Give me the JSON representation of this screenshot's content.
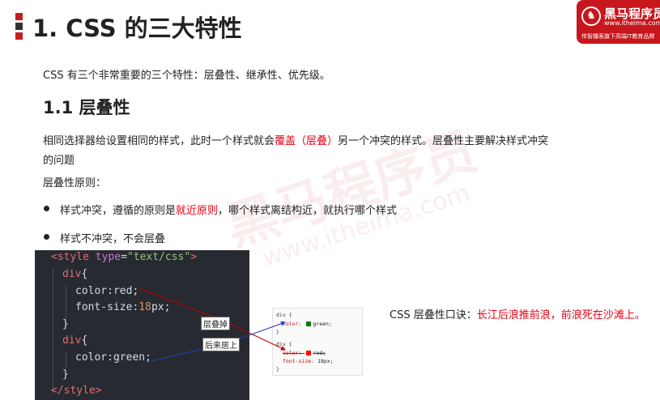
{
  "header": {
    "title": "1. CSS 的三大特性",
    "logo": {
      "name": "黑马程序员",
      "url": "www.itheima.com",
      "slogan": "传智播客旗下高端IT教育品牌"
    }
  },
  "intro": "CSS 有三个非常重要的三个特性：层叠性、继承性、优先级。",
  "section": {
    "heading": "1.1 层叠性",
    "para_a": "相同选择器给设置相同的样式，此时一个样式就会",
    "para_hl": "覆盖（层叠）",
    "para_b": "另一个冲突的样式。层叠性主要解决样式冲突",
    "para_c": "的问题",
    "principle": "层叠性原则：",
    "bullet1_a": "样式冲突，遵循的原则是",
    "bullet1_hl": "就近原则",
    "bullet1_b": "，哪个样式离结构近，就执行哪个样式",
    "bullet2": "样式不冲突，不会层叠"
  },
  "code": {
    "open_tag": "<style",
    "attr_name": " type",
    "eq": "=",
    "attr_value": "\"text/css\"",
    "close_bracket": ">",
    "div1": "div",
    "brace_open1": "{",
    "prop_color": "color",
    "colon1": ":",
    "val_red": "red",
    "semi1": ";",
    "prop_fontsize": "font-size",
    "colon2": ":",
    "val_18": "18",
    "unit_px": "px",
    "semi2": ";",
    "brace_close1": "}",
    "div2": "div",
    "brace_open2": "{",
    "prop_color2": "color",
    "colon3": ":",
    "val_green": "green",
    "semi3": ";",
    "brace_close2": "}",
    "end_tag": "</style>"
  },
  "callouts": {
    "covered": "层叠掉",
    "later_wins": "后来居上"
  },
  "devtools": {
    "block1_open": "div {",
    "block1_prop": "color",
    "block1_val": "green;",
    "block1_close": "}",
    "block2_open": "div {",
    "block2_prop": "color",
    "block2_val": "red;",
    "block2_prop2": "font-size",
    "block2_val2": "18px;",
    "block2_close": "}"
  },
  "mnemonic": {
    "label": "CSS 层叠性口诀：",
    "text": "长江后浪推前浪，前浪死在沙滩上。"
  },
  "watermark": {
    "text": "黑马程序员",
    "url": "www.itheima.com"
  },
  "colors": {
    "accent": "#e60012",
    "brand": "#c8161d",
    "code_bg": "#272a30",
    "swatch_green": "#008000",
    "swatch_red": "#ff0000",
    "arrow_red": "#c00000",
    "arrow_blue": "#1f3fbf"
  }
}
